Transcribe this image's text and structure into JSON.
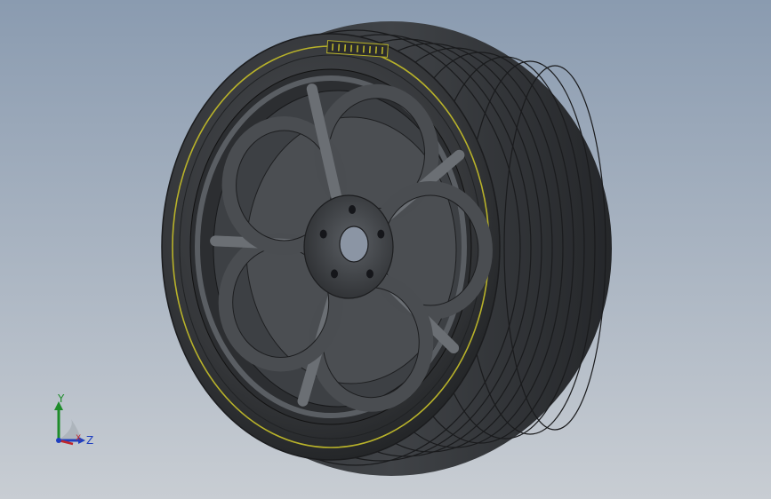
{
  "viewport": {
    "background_top": "#8a9bb0",
    "background_bottom": "#c8cdd3"
  },
  "model": {
    "name": "wheel-assembly",
    "tire_color": "#3a3c3f",
    "tire_tread_color": "#2b2d30",
    "rim_color": "#4a4d51",
    "rim_highlight": "#6b6f74",
    "stripe_color": "#b8b22a",
    "spoke_count": 5,
    "lug_hole_count": 5
  },
  "triad": {
    "y_label": "Y",
    "x_label": "X",
    "z_label": "Z",
    "y_color": "#1e8c2a",
    "x_color": "#c0262b",
    "z_color": "#1f3fbf"
  }
}
